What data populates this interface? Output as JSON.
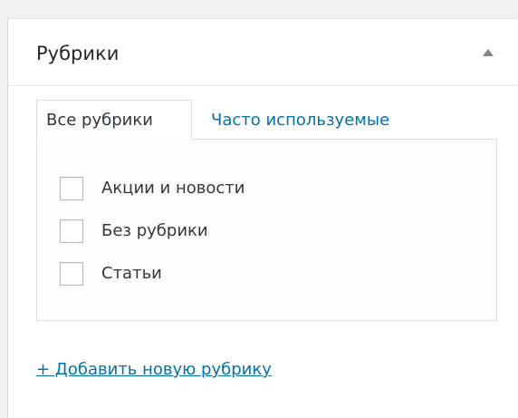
{
  "metabox": {
    "title": "Рубрики",
    "toggle_icon": "triangle-up-icon"
  },
  "tabs": [
    {
      "label": "Все рубрики",
      "active": true
    },
    {
      "label": "Часто используемые",
      "active": false
    }
  ],
  "categories": [
    {
      "label": "Акции и новости",
      "checked": false
    },
    {
      "label": "Без рубрики",
      "checked": false
    },
    {
      "label": "Статьи",
      "checked": false
    }
  ],
  "add_link": "+ Добавить новую рубрику",
  "colors": {
    "link": "#0073aa",
    "text": "#23282d",
    "border": "#dddddd",
    "background": "#f1f1f1"
  }
}
